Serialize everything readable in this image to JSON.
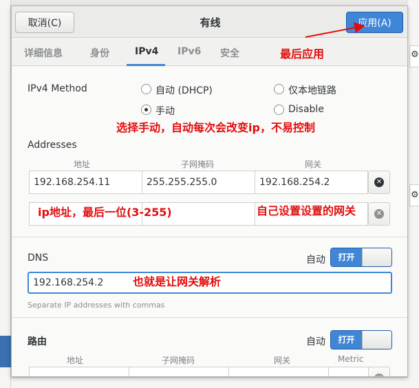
{
  "dialog": {
    "cancel_label": "取消(C)",
    "title": "有线",
    "apply_label": "应用(A)"
  },
  "tabs": [
    "详细信息",
    "身份",
    "IPv4",
    "IPv6",
    "安全"
  ],
  "ipv4": {
    "method_label": "IPv4 Method",
    "options": {
      "auto_dhcp": "自动 (DHCP)",
      "link_local": "仅本地链路",
      "manual": "手动",
      "disable": "Disable"
    },
    "selected": "手动"
  },
  "addresses": {
    "label": "Addresses",
    "columns": [
      "地址",
      "子网掩码",
      "网关"
    ],
    "row1": {
      "address": "192.168.254.11",
      "netmask": "255.255.255.0",
      "gateway": "192.168.254.2"
    }
  },
  "dns": {
    "label": "DNS",
    "auto_label": "自动",
    "toggle_label": "打开",
    "value": "192.168.254.2",
    "hint": "Separate IP addresses with commas"
  },
  "routes": {
    "label": "路由",
    "auto_label": "自动",
    "toggle_label": "打开",
    "columns": [
      "地址",
      "子网掩码",
      "网关",
      "Metric"
    ]
  },
  "annotations": {
    "apply_note": "最后应用",
    "method_note": "选择手动，自动每次会改变ip，不易控制",
    "ip_note": "ip地址，最后一位(3-255)",
    "gateway_note": "自己设置设置的网关",
    "dns_note": "也就是让网关解析"
  },
  "colors": {
    "accent": "#3f86d6",
    "annotation": "#e30c0c"
  }
}
